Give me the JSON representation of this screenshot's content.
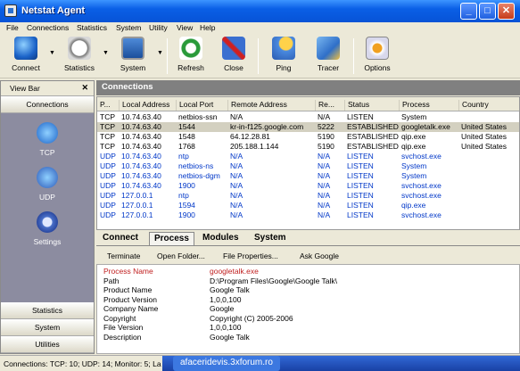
{
  "title": "Netstat Agent",
  "menu": [
    "File",
    "Connections",
    "Statistics",
    "System",
    "Utility",
    "View",
    "Help"
  ],
  "toolbar": [
    {
      "label": "Connect",
      "icon": "globe-icon",
      "drop": true
    },
    {
      "label": "Statistics",
      "icon": "clock-icon",
      "drop": true
    },
    {
      "label": "System",
      "icon": "monitor-icon",
      "drop": true
    },
    {
      "label": "Refresh",
      "icon": "refresh-icon",
      "drop": false
    },
    {
      "label": "Close",
      "icon": "close-connection-icon",
      "drop": false
    },
    {
      "label": "Ping",
      "icon": "ping-icon",
      "drop": false
    },
    {
      "label": "Tracer",
      "icon": "tracer-icon",
      "drop": false
    },
    {
      "label": "Options",
      "icon": "options-icon",
      "drop": false
    }
  ],
  "viewbar": {
    "title": "View Bar",
    "close": "✕",
    "top_button": "Connections",
    "items": [
      {
        "label": "TCP",
        "icon": "tcp-network-icon"
      },
      {
        "label": "UDP",
        "icon": "udp-network-icon"
      },
      {
        "label": "Settings",
        "icon": "gear-icon"
      }
    ],
    "bottom_buttons": [
      "Statistics",
      "System",
      "Utilities"
    ]
  },
  "connections": {
    "title": "Connections",
    "columns": [
      "P...",
      "Local Address",
      "Local Port",
      "Remote Address",
      "Re...",
      "Status",
      "Process",
      "Country"
    ],
    "rows": [
      [
        "TCP",
        "10.74.63.40",
        "netbios-ssn",
        "N/A",
        "N/A",
        "LISTEN",
        "System",
        ""
      ],
      [
        "TCP",
        "10.74.63.40",
        "1544",
        "kr-in-f125.google.com",
        "5222",
        "ESTABLISHED",
        "googletalk.exe",
        "United States"
      ],
      [
        "TCP",
        "10.74.63.40",
        "1548",
        "64.12.28.81",
        "5190",
        "ESTABLISHED",
        "qip.exe",
        "United States"
      ],
      [
        "TCP",
        "10.74.63.40",
        "1768",
        "205.188.1.144",
        "5190",
        "ESTABLISHED",
        "qip.exe",
        "United States"
      ],
      [
        "UDP",
        "10.74.63.40",
        "ntp",
        "N/A",
        "N/A",
        "LISTEN",
        "svchost.exe",
        ""
      ],
      [
        "UDP",
        "10.74.63.40",
        "netbios-ns",
        "N/A",
        "N/A",
        "LISTEN",
        "System",
        ""
      ],
      [
        "UDP",
        "10.74.63.40",
        "netbios-dgm",
        "N/A",
        "N/A",
        "LISTEN",
        "System",
        ""
      ],
      [
        "UDP",
        "10.74.63.40",
        "1900",
        "N/A",
        "N/A",
        "LISTEN",
        "svchost.exe",
        ""
      ],
      [
        "UDP",
        "127.0.0.1",
        "ntp",
        "N/A",
        "N/A",
        "LISTEN",
        "svchost.exe",
        ""
      ],
      [
        "UDP",
        "127.0.0.1",
        "1594",
        "N/A",
        "N/A",
        "LISTEN",
        "qip.exe",
        ""
      ],
      [
        "UDP",
        "127.0.0.1",
        "1900",
        "N/A",
        "N/A",
        "LISTEN",
        "svchost.exe",
        ""
      ]
    ]
  },
  "tabs": [
    "Connect",
    "Process",
    "Modules",
    "System"
  ],
  "active_tab": "Process",
  "actions": [
    "Terminate",
    "Open Folder...",
    "File Properties...",
    "Ask Google"
  ],
  "details": [
    [
      "Process Name",
      "googletalk.exe"
    ],
    [
      "Path",
      "D:\\Program Files\\Google\\Google Talk\\"
    ],
    [
      "Product Name",
      "Google Talk"
    ],
    [
      "Product Version",
      "1,0,0,100"
    ],
    [
      "Company Name",
      "Google"
    ],
    [
      "Copyright",
      "Copyright (C) 2005-2006"
    ],
    [
      "File Version",
      "1,0,0,100"
    ],
    [
      "Description",
      "Google Talk"
    ]
  ],
  "status": "Connections: TCP: 10; UDP: 14; Monitor: 5; La",
  "taskbar_item": "afaceridevis.3xforum.ro",
  "colors": {
    "titlebar": "#0753d6",
    "udp_text": "#0037c8",
    "highlight_text": "#c02020",
    "viewbar_panel": "#8c8ca0"
  }
}
